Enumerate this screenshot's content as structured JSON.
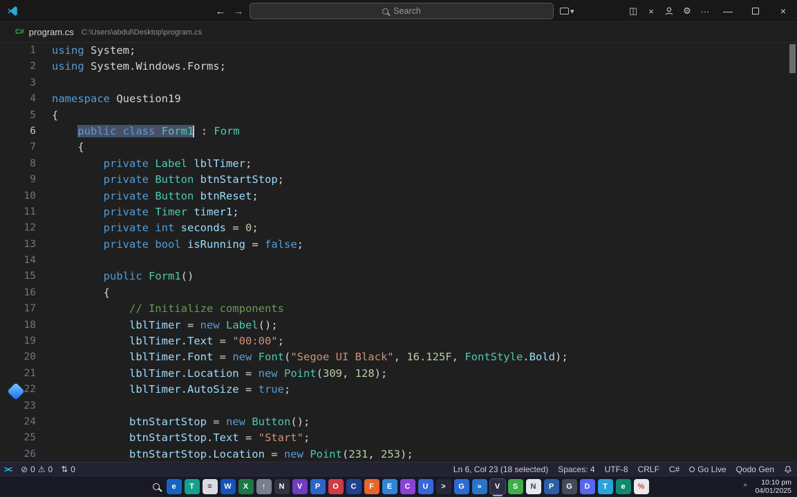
{
  "titlebar": {
    "search_placeholder": "Search",
    "back_glyph": "←",
    "forward_glyph": "→",
    "cast_chevron": "▾",
    "layout_glyph": "◫",
    "x_glyph": "×",
    "gear_glyph": "⚙",
    "more_glyph": "···",
    "minimize_glyph": "—",
    "close_glyph": "×"
  },
  "tab": {
    "file_icon": "C#",
    "file_name": "program.cs",
    "file_path": "C:\\Users\\abdul\\Desktop\\program.cs"
  },
  "editor": {
    "lines": [
      {
        "n": 1,
        "s": [
          {
            "t": "using",
            "c": "kw"
          },
          {
            "t": " System;",
            "c": "pl"
          }
        ]
      },
      {
        "n": 2,
        "s": [
          {
            "t": "using",
            "c": "kw"
          },
          {
            "t": " System.Windows.Forms;",
            "c": "pl"
          }
        ]
      },
      {
        "n": 3,
        "s": []
      },
      {
        "n": 4,
        "s": [
          {
            "t": "namespace",
            "c": "kw"
          },
          {
            "t": " Question19",
            "c": "pl"
          }
        ]
      },
      {
        "n": 5,
        "s": [
          {
            "t": "{",
            "c": "pl"
          }
        ]
      },
      {
        "n": 6,
        "active": true,
        "s": [
          {
            "t": "    ",
            "c": "pl"
          },
          {
            "t": "public",
            "c": "kw",
            "sel": true
          },
          {
            "t": " ",
            "c": "pl",
            "sel": true
          },
          {
            "t": "class",
            "c": "kw",
            "sel": true
          },
          {
            "t": " ",
            "c": "pl",
            "sel": true
          },
          {
            "t": "Form1",
            "c": "ty",
            "sel": true
          },
          {
            "cursor": true
          },
          {
            "t": " : ",
            "c": "pl"
          },
          {
            "t": "Form",
            "c": "ty"
          }
        ]
      },
      {
        "n": 7,
        "s": [
          {
            "t": "    {",
            "c": "pl"
          }
        ]
      },
      {
        "n": 8,
        "s": [
          {
            "t": "        ",
            "c": "pl"
          },
          {
            "t": "private",
            "c": "kw"
          },
          {
            "t": " ",
            "c": "pl"
          },
          {
            "t": "Label",
            "c": "ty"
          },
          {
            "t": " ",
            "c": "pl"
          },
          {
            "t": "lblTimer",
            "c": "fld"
          },
          {
            "t": ";",
            "c": "pl"
          }
        ]
      },
      {
        "n": 9,
        "s": [
          {
            "t": "        ",
            "c": "pl"
          },
          {
            "t": "private",
            "c": "kw"
          },
          {
            "t": " ",
            "c": "pl"
          },
          {
            "t": "Button",
            "c": "ty"
          },
          {
            "t": " ",
            "c": "pl"
          },
          {
            "t": "btnStartStop",
            "c": "fld"
          },
          {
            "t": ";",
            "c": "pl"
          }
        ]
      },
      {
        "n": 10,
        "s": [
          {
            "t": "        ",
            "c": "pl"
          },
          {
            "t": "private",
            "c": "kw"
          },
          {
            "t": " ",
            "c": "pl"
          },
          {
            "t": "Button",
            "c": "ty"
          },
          {
            "t": " ",
            "c": "pl"
          },
          {
            "t": "btnReset",
            "c": "fld"
          },
          {
            "t": ";",
            "c": "pl"
          }
        ]
      },
      {
        "n": 11,
        "s": [
          {
            "t": "        ",
            "c": "pl"
          },
          {
            "t": "private",
            "c": "kw"
          },
          {
            "t": " ",
            "c": "pl"
          },
          {
            "t": "Timer",
            "c": "ty"
          },
          {
            "t": " ",
            "c": "pl"
          },
          {
            "t": "timer1",
            "c": "fld"
          },
          {
            "t": ";",
            "c": "pl"
          }
        ]
      },
      {
        "n": 12,
        "s": [
          {
            "t": "        ",
            "c": "pl"
          },
          {
            "t": "private",
            "c": "kw"
          },
          {
            "t": " ",
            "c": "pl"
          },
          {
            "t": "int",
            "c": "kw"
          },
          {
            "t": " ",
            "c": "pl"
          },
          {
            "t": "seconds",
            "c": "fld"
          },
          {
            "t": " = ",
            "c": "pl"
          },
          {
            "t": "0",
            "c": "num"
          },
          {
            "t": ";",
            "c": "pl"
          }
        ]
      },
      {
        "n": 13,
        "s": [
          {
            "t": "        ",
            "c": "pl"
          },
          {
            "t": "private",
            "c": "kw"
          },
          {
            "t": " ",
            "c": "pl"
          },
          {
            "t": "bool",
            "c": "kw"
          },
          {
            "t": " ",
            "c": "pl"
          },
          {
            "t": "isRunning",
            "c": "fld"
          },
          {
            "t": " = ",
            "c": "pl"
          },
          {
            "t": "false",
            "c": "kw"
          },
          {
            "t": ";",
            "c": "pl"
          }
        ]
      },
      {
        "n": 14,
        "s": []
      },
      {
        "n": 15,
        "s": [
          {
            "t": "        ",
            "c": "pl"
          },
          {
            "t": "public",
            "c": "kw"
          },
          {
            "t": " ",
            "c": "pl"
          },
          {
            "t": "Form1",
            "c": "ty"
          },
          {
            "t": "()",
            "c": "pl"
          }
        ]
      },
      {
        "n": 16,
        "s": [
          {
            "t": "        {",
            "c": "pl"
          }
        ]
      },
      {
        "n": 17,
        "s": [
          {
            "t": "            ",
            "c": "pl"
          },
          {
            "t": "// Initialize components",
            "c": "cmt"
          }
        ]
      },
      {
        "n": 18,
        "s": [
          {
            "t": "            ",
            "c": "pl"
          },
          {
            "t": "lblTimer",
            "c": "fld"
          },
          {
            "t": " = ",
            "c": "pl"
          },
          {
            "t": "new",
            "c": "kw"
          },
          {
            "t": " ",
            "c": "pl"
          },
          {
            "t": "Label",
            "c": "ty"
          },
          {
            "t": "();",
            "c": "pl"
          }
        ]
      },
      {
        "n": 19,
        "s": [
          {
            "t": "            ",
            "c": "pl"
          },
          {
            "t": "lblTimer",
            "c": "fld"
          },
          {
            "t": ".",
            "c": "pl"
          },
          {
            "t": "Text",
            "c": "fld"
          },
          {
            "t": " = ",
            "c": "pl"
          },
          {
            "t": "\"00:00\"",
            "c": "str"
          },
          {
            "t": ";",
            "c": "pl"
          }
        ]
      },
      {
        "n": 20,
        "s": [
          {
            "t": "            ",
            "c": "pl"
          },
          {
            "t": "lblTimer",
            "c": "fld"
          },
          {
            "t": ".",
            "c": "pl"
          },
          {
            "t": "Font",
            "c": "fld"
          },
          {
            "t": " = ",
            "c": "pl"
          },
          {
            "t": "new",
            "c": "kw"
          },
          {
            "t": " ",
            "c": "pl"
          },
          {
            "t": "Font",
            "c": "ty"
          },
          {
            "t": "(",
            "c": "pl"
          },
          {
            "t": "\"Segoe UI Black\"",
            "c": "str"
          },
          {
            "t": ", ",
            "c": "pl"
          },
          {
            "t": "16.125F",
            "c": "num"
          },
          {
            "t": ", ",
            "c": "pl"
          },
          {
            "t": "FontStyle",
            "c": "ty"
          },
          {
            "t": ".",
            "c": "pl"
          },
          {
            "t": "Bold",
            "c": "fld"
          },
          {
            "t": ");",
            "c": "pl"
          }
        ]
      },
      {
        "n": 21,
        "s": [
          {
            "t": "            ",
            "c": "pl"
          },
          {
            "t": "lblTimer",
            "c": "fld"
          },
          {
            "t": ".",
            "c": "pl"
          },
          {
            "t": "Location",
            "c": "fld"
          },
          {
            "t": " = ",
            "c": "pl"
          },
          {
            "t": "new",
            "c": "kw"
          },
          {
            "t": " ",
            "c": "pl"
          },
          {
            "t": "Point",
            "c": "ty"
          },
          {
            "t": "(",
            "c": "pl"
          },
          {
            "t": "309",
            "c": "num"
          },
          {
            "t": ", ",
            "c": "pl"
          },
          {
            "t": "128",
            "c": "num"
          },
          {
            "t": ");",
            "c": "pl"
          }
        ]
      },
      {
        "n": 22,
        "s": [
          {
            "t": "            ",
            "c": "pl"
          },
          {
            "t": "lblTimer",
            "c": "fld"
          },
          {
            "t": ".",
            "c": "pl"
          },
          {
            "t": "AutoSize",
            "c": "fld"
          },
          {
            "t": " = ",
            "c": "pl"
          },
          {
            "t": "true",
            "c": "kw"
          },
          {
            "t": ";",
            "c": "pl"
          }
        ]
      },
      {
        "n": 23,
        "s": []
      },
      {
        "n": 24,
        "s": [
          {
            "t": "            ",
            "c": "pl"
          },
          {
            "t": "btnStartStop",
            "c": "fld"
          },
          {
            "t": " = ",
            "c": "pl"
          },
          {
            "t": "new",
            "c": "kw"
          },
          {
            "t": " ",
            "c": "pl"
          },
          {
            "t": "Button",
            "c": "ty"
          },
          {
            "t": "();",
            "c": "pl"
          }
        ]
      },
      {
        "n": 25,
        "s": [
          {
            "t": "            ",
            "c": "pl"
          },
          {
            "t": "btnStartStop",
            "c": "fld"
          },
          {
            "t": ".",
            "c": "pl"
          },
          {
            "t": "Text",
            "c": "fld"
          },
          {
            "t": " = ",
            "c": "pl"
          },
          {
            "t": "\"Start\"",
            "c": "str"
          },
          {
            "t": ";",
            "c": "pl"
          }
        ]
      },
      {
        "n": 26,
        "s": [
          {
            "t": "            ",
            "c": "pl"
          },
          {
            "t": "btnStartStop",
            "c": "fld"
          },
          {
            "t": ".",
            "c": "pl"
          },
          {
            "t": "Location",
            "c": "fld"
          },
          {
            "t": " = ",
            "c": "pl"
          },
          {
            "t": "new",
            "c": "kw"
          },
          {
            "t": " ",
            "c": "pl"
          },
          {
            "t": "Point",
            "c": "ty"
          },
          {
            "t": "(",
            "c": "pl"
          },
          {
            "t": "231",
            "c": "num"
          },
          {
            "t": ", ",
            "c": "pl"
          },
          {
            "t": "253",
            "c": "num"
          },
          {
            "t": ");",
            "c": "pl"
          }
        ]
      }
    ]
  },
  "statusbar": {
    "left": {
      "errors": "0",
      "warnings": "0",
      "ports": "0"
    },
    "error_glyph": "⊘",
    "warning_glyph": "⚠",
    "ports_glyph": "⇅",
    "right_items": [
      {
        "name": "cursor-position",
        "label": "Ln 6, Col 23 (18 selected)"
      },
      {
        "name": "indentation",
        "label": "Spaces: 4"
      },
      {
        "name": "encoding",
        "label": "UTF-8"
      },
      {
        "name": "eol",
        "label": "CRLF"
      },
      {
        "name": "language-mode",
        "label": "C#"
      },
      {
        "name": "go-live",
        "label": "Go Live",
        "icon": "broadcast"
      },
      {
        "name": "qodo-gen",
        "label": "Qodo Gen"
      }
    ]
  },
  "taskbar": {
    "icons": [
      {
        "name": "search",
        "cls": "magnifier",
        "bg": "transparent",
        "g": ""
      },
      {
        "name": "edge-browser",
        "g": "e",
        "bg": "#1565c0"
      },
      {
        "name": "teams",
        "g": "T",
        "bg": "#13a08c"
      },
      {
        "name": "calculator",
        "g": "=",
        "bg": "#d9dde3",
        "fg": "#333333"
      },
      {
        "name": "word",
        "g": "W",
        "bg": "#1653b8"
      },
      {
        "name": "excel",
        "g": "X",
        "bg": "#1a7a44"
      },
      {
        "name": "steam",
        "g": "↑",
        "bg": "#77808c"
      },
      {
        "name": "notepad-plus",
        "g": "N",
        "bg": "#30343f"
      },
      {
        "name": "visual-studio",
        "g": "V",
        "bg": "#703cc4"
      },
      {
        "name": "photos-app",
        "g": "P",
        "bg": "#2a66c8"
      },
      {
        "name": "opera-browser",
        "g": "O",
        "bg": "#d13b45"
      },
      {
        "name": "app-navy-circle",
        "g": "C",
        "bg": "#20418f"
      },
      {
        "name": "firefox-browser",
        "g": "F",
        "bg": "#e8642c"
      },
      {
        "name": "file-explorer",
        "g": "E",
        "bg": "#2f86d6"
      },
      {
        "name": "camera-app",
        "g": "C",
        "bg": "#8a41d8"
      },
      {
        "name": "app-blue-u",
        "g": "U",
        "bg": "#3668d8"
      },
      {
        "name": "terminal",
        "g": ">",
        "bg": "#23283a"
      },
      {
        "name": "chrome-browser",
        "g": "G",
        "bg": "#2b6cd4"
      },
      {
        "name": "app-blue-arrow",
        "g": "»",
        "bg": "#2776c8"
      },
      {
        "name": "vscode",
        "g": "V",
        "bg": "#2aa8e0",
        "active": true
      },
      {
        "name": "sublime-app",
        "g": "S",
        "bg": "#3fae49"
      },
      {
        "name": "notepad",
        "g": "N",
        "bg": "#e4e7ec",
        "fg": "#444444"
      },
      {
        "name": "python-app",
        "g": "P",
        "bg": "#2b5fa8"
      },
      {
        "name": "github-desktop",
        "g": "G",
        "bg": "#454b58"
      },
      {
        "name": "discord",
        "g": "D",
        "bg": "#5865f2"
      },
      {
        "name": "telegram",
        "g": "T",
        "bg": "#2aa3dd"
      },
      {
        "name": "edge-dev",
        "g": "e",
        "bg": "#0f8a6e"
      },
      {
        "name": "pie-chart-app",
        "g": "%",
        "bg": "#e8eaee",
        "fg": "#d04545"
      }
    ],
    "tray_chevron": "^",
    "clock": {
      "time": "10:10 pm",
      "date": "04/01/2025"
    }
  }
}
